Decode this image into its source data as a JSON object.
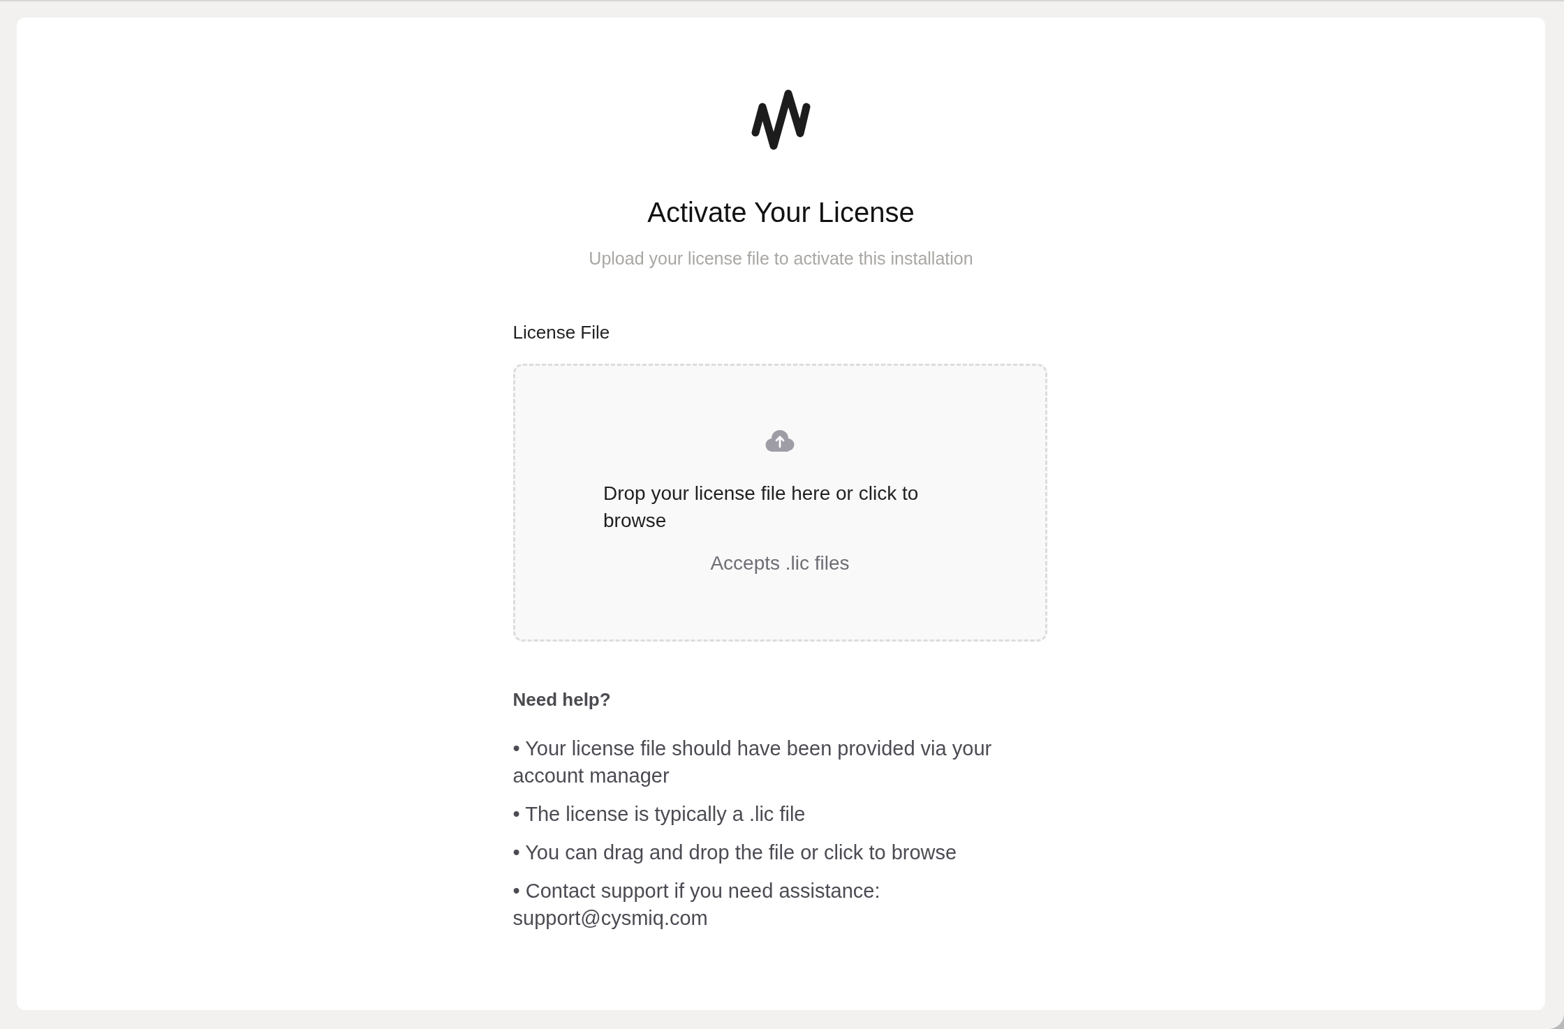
{
  "header": {
    "title": "Activate Your License",
    "subtitle": "Upload your license file to activate this installation"
  },
  "license_file": {
    "label": "License File",
    "dropzone": {
      "prompt": "Drop your license file here or click to browse",
      "hint": "Accepts .lic files"
    }
  },
  "help": {
    "heading": "Need help?",
    "items": [
      "• Your license file should have been provided via your account manager",
      "• The license is typically a .lic file",
      "• You can drag and drop the file or click to browse",
      "• Contact support if you need assistance: support@cysmiq.com"
    ]
  }
}
